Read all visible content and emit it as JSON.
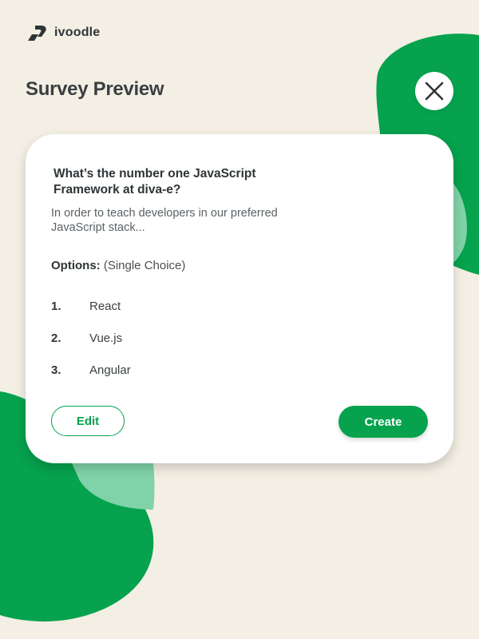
{
  "brand": {
    "name": "ivoodle",
    "logo_icon": "ivoodle-logo-icon"
  },
  "header": {
    "title": "Survey Preview",
    "close_icon": "close-icon"
  },
  "survey": {
    "question": "What’s the number one JavaScript Framework at diva-e?",
    "description": "In order to teach developers in our preferred JavaScript stack...",
    "options_label": "Options:",
    "options_type": "(Single Choice)",
    "options": [
      {
        "number": "1.",
        "text": "React"
      },
      {
        "number": "2.",
        "text": "Vue.js"
      },
      {
        "number": "3.",
        "text": "Angular"
      }
    ]
  },
  "actions": {
    "edit_label": "Edit",
    "create_label": "Create"
  },
  "colors": {
    "background": "#f4efe4",
    "accent_green": "#06a24e",
    "light_green": "#80d2a8",
    "card": "#ffffff",
    "text_dark": "#2f3437"
  }
}
